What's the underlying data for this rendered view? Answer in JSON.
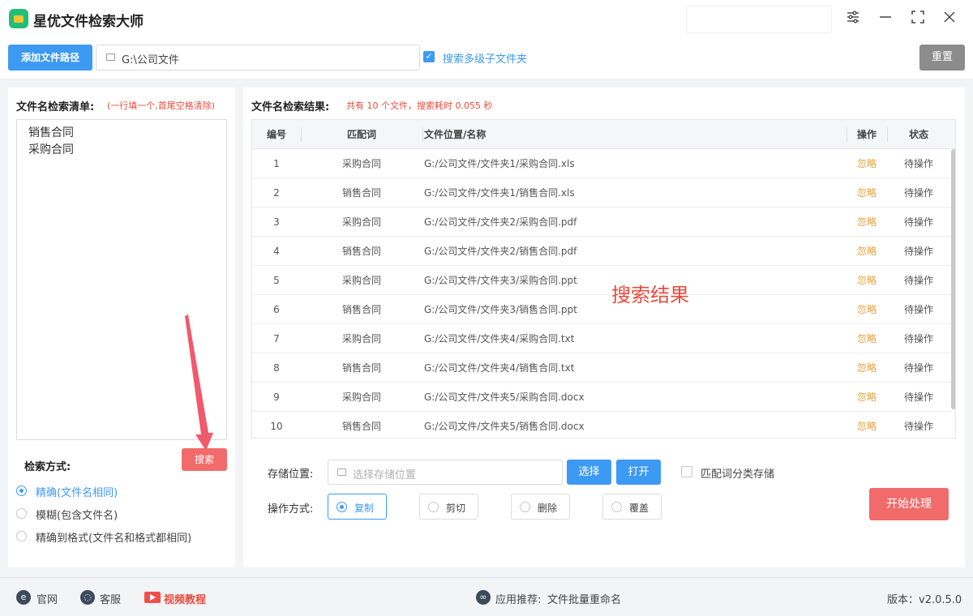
{
  "app": {
    "title": "星优文件检索大师"
  },
  "toolbar": {
    "add_path_label": "添加文件路径",
    "path_value": "G:\\公司文件",
    "subfolder_label": "搜索多级子文件夹",
    "subfolder_checked": true,
    "reset_label": "重置"
  },
  "left": {
    "list_title": "文件名检索清单:",
    "list_hint": "(一行填一个,首尾空格清除)",
    "list_items": [
      "销售合同",
      "采购合同"
    ],
    "search_label": "搜索",
    "mode_title": "检索方式:",
    "modes": [
      {
        "label": "精确(文件名相同)",
        "selected": true
      },
      {
        "label": "模糊(包含文件名)",
        "selected": false
      },
      {
        "label": "精确到格式(文件名和格式都相同)",
        "selected": false
      }
    ]
  },
  "results": {
    "title": "文件名检索结果:",
    "summary": "共有 10 个文件，搜索耗时 0.055 秒",
    "columns": [
      "编号",
      "匹配词",
      "文件位置/名称",
      "操作",
      "状态"
    ],
    "rows": [
      [
        "1",
        "采购合同",
        "G:/公司文件/文件夹1/采购合同.xls",
        "忽略",
        "待操作"
      ],
      [
        "2",
        "销售合同",
        "G:/公司文件/文件夹1/销售合同.xls",
        "忽略",
        "待操作"
      ],
      [
        "3",
        "采购合同",
        "G:/公司文件/文件夹2/采购合同.pdf",
        "忽略",
        "待操作"
      ],
      [
        "4",
        "销售合同",
        "G:/公司文件/文件夹2/销售合同.pdf",
        "忽略",
        "待操作"
      ],
      [
        "5",
        "采购合同",
        "G:/公司文件/文件夹3/采购合同.ppt",
        "忽略",
        "待操作"
      ],
      [
        "6",
        "销售合同",
        "G:/公司文件/文件夹3/销售合同.ppt",
        "忽略",
        "待操作"
      ],
      [
        "7",
        "采购合同",
        "G:/公司文件/文件夹4/采购合同.txt",
        "忽略",
        "待操作"
      ],
      [
        "8",
        "销售合同",
        "G:/公司文件/文件夹4/销售合同.txt",
        "忽略",
        "待操作"
      ],
      [
        "9",
        "采购合同",
        "G:/公司文件/文件夹5/采购合同.docx",
        "忽略",
        "待操作"
      ],
      [
        "10",
        "销售合同",
        "G:/公司文件/文件夹5/销售合同.docx",
        "忽略",
        "待操作"
      ]
    ],
    "annotation": "搜索结果"
  },
  "storage": {
    "label": "存储位置:",
    "placeholder": "选择存储位置",
    "select_label": "选择",
    "open_label": "打开",
    "classify_label": "匹配词分类存储",
    "classify_checked": false
  },
  "operation": {
    "label": "操作方式:",
    "options": [
      {
        "label": "复制",
        "selected": true
      },
      {
        "label": "剪切",
        "selected": false
      },
      {
        "label": "删除",
        "selected": false
      },
      {
        "label": "覆盖",
        "selected": false
      }
    ],
    "start_label": "开始处理"
  },
  "footer": {
    "website_label": "官网",
    "service_label": "客服",
    "video_label": "视频教程",
    "recommend_label": "应用推荐:",
    "recommend_app": "文件批量重命名",
    "version_label": "版本：v2.0.5.0"
  },
  "colors": {
    "accent": "#3d9af3",
    "danger": "#f26b6b",
    "warning": "#e6a23c",
    "brand": "#1fbf7a"
  },
  "icons": [
    "app-logo",
    "settings-sliders-icon",
    "minimize-icon",
    "maximize-icon",
    "close-icon",
    "folder-icon",
    "checkbox-icon",
    "radio-icon",
    "arrow-annotation",
    "ie-icon",
    "chat-icon",
    "video-icon",
    "link-icon"
  ]
}
